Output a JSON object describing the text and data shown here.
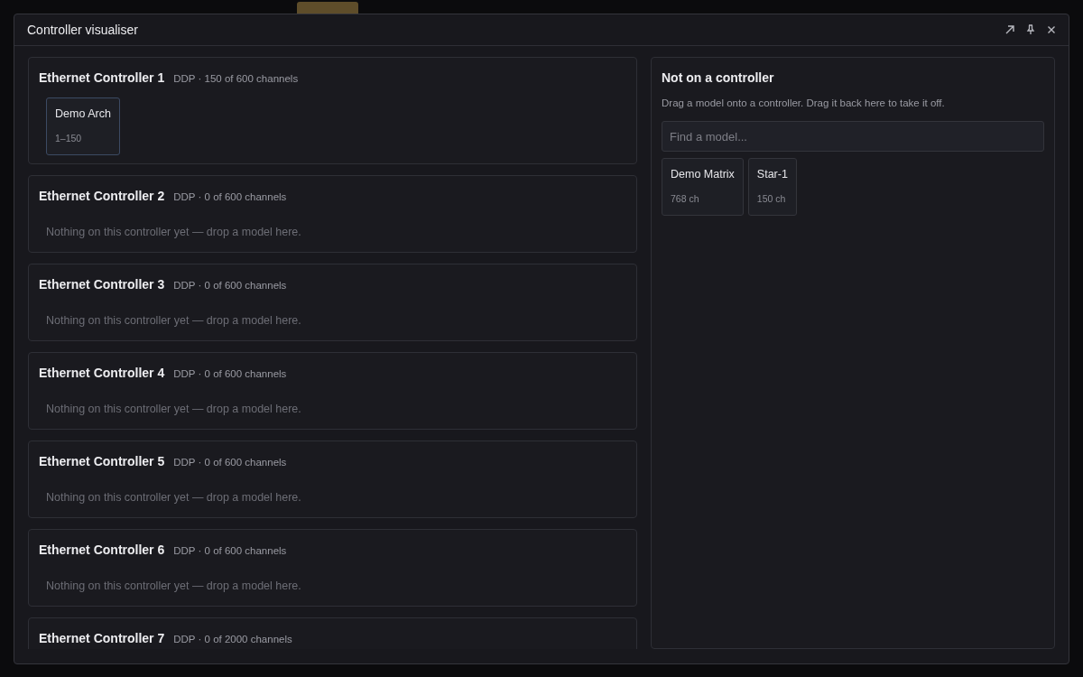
{
  "window": {
    "title": "Controller visualiser"
  },
  "controllers": [
    {
      "name": "Ethernet Controller 1",
      "summary": "DDP · 150 of 600 channels",
      "models": [
        {
          "name": "Demo Arch",
          "detail": "1–150",
          "selected": true
        }
      ]
    },
    {
      "name": "Ethernet Controller 2",
      "summary": "DDP · 0 of 600 channels",
      "empty_text": "Nothing on this controller yet — drop a model here."
    },
    {
      "name": "Ethernet Controller 3",
      "summary": "DDP · 0 of 600 channels",
      "empty_text": "Nothing on this controller yet — drop a model here."
    },
    {
      "name": "Ethernet Controller 4",
      "summary": "DDP · 0 of 600 channels",
      "empty_text": "Nothing on this controller yet — drop a model here."
    },
    {
      "name": "Ethernet Controller 5",
      "summary": "DDP · 0 of 600 channels",
      "empty_text": "Nothing on this controller yet — drop a model here."
    },
    {
      "name": "Ethernet Controller 6",
      "summary": "DDP · 0 of 600 channels",
      "empty_text": "Nothing on this controller yet — drop a model here."
    },
    {
      "name": "Ethernet Controller 7",
      "summary": "DDP · 0 of 2000 channels"
    }
  ],
  "unassigned": {
    "title": "Not on a controller",
    "hint": "Drag a model onto a controller. Drag it back here to take it off.",
    "search": {
      "placeholder": "Find a model..."
    },
    "models": [
      {
        "name": "Demo Matrix",
        "detail": "768 ch",
        "selected": false
      },
      {
        "name": "Star-1",
        "detail": "150 ch",
        "selected": false
      }
    ]
  }
}
